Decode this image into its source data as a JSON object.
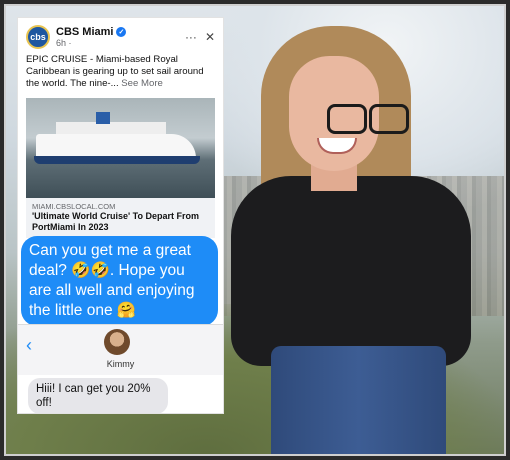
{
  "post": {
    "source_name": "CBS Miami",
    "avatar_text": "cbs",
    "verified_icon": "✓",
    "time": "6h · ",
    "more_label": "···",
    "close_label": "✕",
    "text": "EPIC CRUISE - Miami-based Royal Caribbean is gearing up to set sail around the world. The nine-... ",
    "see_more": "See More",
    "image_icon": "cruise-ship",
    "link_domain": "MIAMI.CBSLOCAL.COM",
    "link_title": "'Ultimate World Cruise' To Depart From PortMiami In 2023"
  },
  "messages": {
    "outgoing": "Can you get me a great deal? 🤣🤣. Hope you are all well and enjoying the little one 🤗",
    "back_label": "‹",
    "contact_name": "Kimmy",
    "incoming": "Hiii! I can get you 20% off!"
  },
  "colors": {
    "imessage_blue": "#1e8cf7",
    "incoming_gray": "#e6e6ea",
    "frame": "#2b2b2b"
  }
}
